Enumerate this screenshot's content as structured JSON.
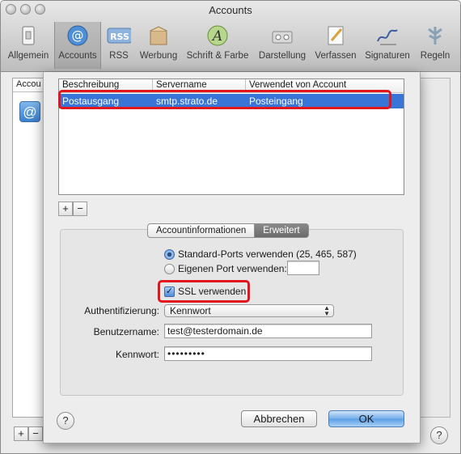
{
  "window": {
    "title": "Accounts"
  },
  "toolbar": [
    {
      "label": "Allgemein",
      "icon": "switch-icon"
    },
    {
      "label": "Accounts",
      "icon": "at-icon"
    },
    {
      "label": "RSS",
      "icon": "rss-icon"
    },
    {
      "label": "Werbung",
      "icon": "package-icon"
    },
    {
      "label": "Schrift & Farbe",
      "icon": "font-icon"
    },
    {
      "label": "Darstellung",
      "icon": "glasses-icon"
    },
    {
      "label": "Verfassen",
      "icon": "pencil-icon"
    },
    {
      "label": "Signaturen",
      "icon": "signature-icon"
    },
    {
      "label": "Regeln",
      "icon": "rules-icon"
    }
  ],
  "background": {
    "list_header": "Accou"
  },
  "table": {
    "headers": [
      "Beschreibung",
      "Servername",
      "Verwendet von Account"
    ],
    "row": [
      "Postausgang",
      "smtp.strato.de",
      "Posteingang"
    ]
  },
  "controls": {
    "add": "+",
    "remove": "−",
    "help": "?"
  },
  "tabs": {
    "info": "Accountinformationen",
    "advanced": "Erweitert"
  },
  "advanced": {
    "port_standard": "Standard-Ports verwenden (25, 465, 587)",
    "port_custom": "Eigenen Port verwenden:",
    "port_value": "",
    "ssl_label": "SSL verwenden",
    "auth_label": "Authentifizierung:",
    "auth_value": "Kennwort",
    "user_label": "Benutzername:",
    "user_value": "test@testerdomain.de",
    "password_label": "Kennwort:",
    "password_value": "•••••••••"
  },
  "buttons": {
    "cancel": "Abbrechen",
    "ok": "OK"
  },
  "colors": {
    "selection": "#3875d7",
    "highlight": "#e0161c"
  }
}
